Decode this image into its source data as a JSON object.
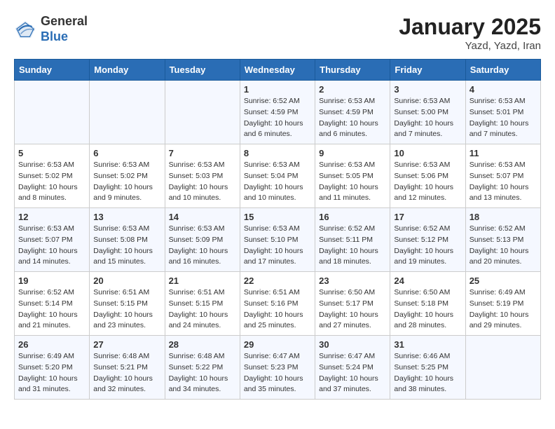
{
  "header": {
    "logo_line1": "General",
    "logo_line2": "Blue",
    "title": "January 2025",
    "subtitle": "Yazd, Yazd, Iran"
  },
  "weekdays": [
    "Sunday",
    "Monday",
    "Tuesday",
    "Wednesday",
    "Thursday",
    "Friday",
    "Saturday"
  ],
  "weeks": [
    [
      {
        "day": "",
        "info": ""
      },
      {
        "day": "",
        "info": ""
      },
      {
        "day": "",
        "info": ""
      },
      {
        "day": "1",
        "info": "Sunrise: 6:52 AM\nSunset: 4:59 PM\nDaylight: 10 hours\nand 6 minutes."
      },
      {
        "day": "2",
        "info": "Sunrise: 6:53 AM\nSunset: 4:59 PM\nDaylight: 10 hours\nand 6 minutes."
      },
      {
        "day": "3",
        "info": "Sunrise: 6:53 AM\nSunset: 5:00 PM\nDaylight: 10 hours\nand 7 minutes."
      },
      {
        "day": "4",
        "info": "Sunrise: 6:53 AM\nSunset: 5:01 PM\nDaylight: 10 hours\nand 7 minutes."
      }
    ],
    [
      {
        "day": "5",
        "info": "Sunrise: 6:53 AM\nSunset: 5:02 PM\nDaylight: 10 hours\nand 8 minutes."
      },
      {
        "day": "6",
        "info": "Sunrise: 6:53 AM\nSunset: 5:02 PM\nDaylight: 10 hours\nand 9 minutes."
      },
      {
        "day": "7",
        "info": "Sunrise: 6:53 AM\nSunset: 5:03 PM\nDaylight: 10 hours\nand 10 minutes."
      },
      {
        "day": "8",
        "info": "Sunrise: 6:53 AM\nSunset: 5:04 PM\nDaylight: 10 hours\nand 10 minutes."
      },
      {
        "day": "9",
        "info": "Sunrise: 6:53 AM\nSunset: 5:05 PM\nDaylight: 10 hours\nand 11 minutes."
      },
      {
        "day": "10",
        "info": "Sunrise: 6:53 AM\nSunset: 5:06 PM\nDaylight: 10 hours\nand 12 minutes."
      },
      {
        "day": "11",
        "info": "Sunrise: 6:53 AM\nSunset: 5:07 PM\nDaylight: 10 hours\nand 13 minutes."
      }
    ],
    [
      {
        "day": "12",
        "info": "Sunrise: 6:53 AM\nSunset: 5:07 PM\nDaylight: 10 hours\nand 14 minutes."
      },
      {
        "day": "13",
        "info": "Sunrise: 6:53 AM\nSunset: 5:08 PM\nDaylight: 10 hours\nand 15 minutes."
      },
      {
        "day": "14",
        "info": "Sunrise: 6:53 AM\nSunset: 5:09 PM\nDaylight: 10 hours\nand 16 minutes."
      },
      {
        "day": "15",
        "info": "Sunrise: 6:53 AM\nSunset: 5:10 PM\nDaylight: 10 hours\nand 17 minutes."
      },
      {
        "day": "16",
        "info": "Sunrise: 6:52 AM\nSunset: 5:11 PM\nDaylight: 10 hours\nand 18 minutes."
      },
      {
        "day": "17",
        "info": "Sunrise: 6:52 AM\nSunset: 5:12 PM\nDaylight: 10 hours\nand 19 minutes."
      },
      {
        "day": "18",
        "info": "Sunrise: 6:52 AM\nSunset: 5:13 PM\nDaylight: 10 hours\nand 20 minutes."
      }
    ],
    [
      {
        "day": "19",
        "info": "Sunrise: 6:52 AM\nSunset: 5:14 PM\nDaylight: 10 hours\nand 21 minutes."
      },
      {
        "day": "20",
        "info": "Sunrise: 6:51 AM\nSunset: 5:15 PM\nDaylight: 10 hours\nand 23 minutes."
      },
      {
        "day": "21",
        "info": "Sunrise: 6:51 AM\nSunset: 5:15 PM\nDaylight: 10 hours\nand 24 minutes."
      },
      {
        "day": "22",
        "info": "Sunrise: 6:51 AM\nSunset: 5:16 PM\nDaylight: 10 hours\nand 25 minutes."
      },
      {
        "day": "23",
        "info": "Sunrise: 6:50 AM\nSunset: 5:17 PM\nDaylight: 10 hours\nand 27 minutes."
      },
      {
        "day": "24",
        "info": "Sunrise: 6:50 AM\nSunset: 5:18 PM\nDaylight: 10 hours\nand 28 minutes."
      },
      {
        "day": "25",
        "info": "Sunrise: 6:49 AM\nSunset: 5:19 PM\nDaylight: 10 hours\nand 29 minutes."
      }
    ],
    [
      {
        "day": "26",
        "info": "Sunrise: 6:49 AM\nSunset: 5:20 PM\nDaylight: 10 hours\nand 31 minutes."
      },
      {
        "day": "27",
        "info": "Sunrise: 6:48 AM\nSunset: 5:21 PM\nDaylight: 10 hours\nand 32 minutes."
      },
      {
        "day": "28",
        "info": "Sunrise: 6:48 AM\nSunset: 5:22 PM\nDaylight: 10 hours\nand 34 minutes."
      },
      {
        "day": "29",
        "info": "Sunrise: 6:47 AM\nSunset: 5:23 PM\nDaylight: 10 hours\nand 35 minutes."
      },
      {
        "day": "30",
        "info": "Sunrise: 6:47 AM\nSunset: 5:24 PM\nDaylight: 10 hours\nand 37 minutes."
      },
      {
        "day": "31",
        "info": "Sunrise: 6:46 AM\nSunset: 5:25 PM\nDaylight: 10 hours\nand 38 minutes."
      },
      {
        "day": "",
        "info": ""
      }
    ]
  ]
}
